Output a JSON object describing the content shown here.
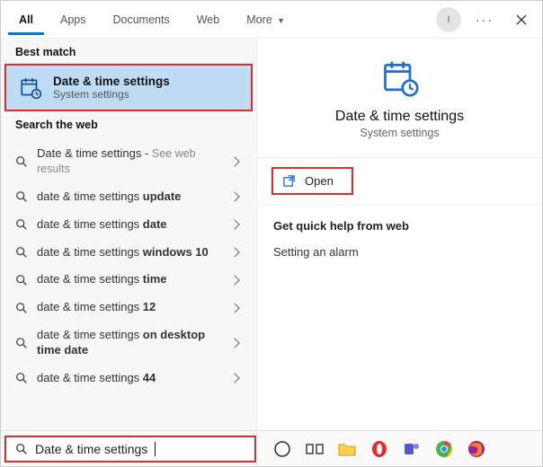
{
  "topbar": {
    "tabs": [
      {
        "label": "All",
        "active": true
      },
      {
        "label": "Apps",
        "active": false
      },
      {
        "label": "Documents",
        "active": false
      },
      {
        "label": "Web",
        "active": false
      }
    ],
    "more_label": "More",
    "avatar_initial": "I"
  },
  "left": {
    "best_match_label": "Best match",
    "best_match": {
      "title": "Date & time settings",
      "subtitle": "System settings"
    },
    "search_web_label": "Search the web",
    "web_items": [
      {
        "prefix": "Date & time settings",
        "bold": "",
        "aside": "See web results"
      },
      {
        "prefix": "date & time settings ",
        "bold": "update",
        "aside": ""
      },
      {
        "prefix": "date & time settings ",
        "bold": "date",
        "aside": ""
      },
      {
        "prefix": "date & time settings ",
        "bold": "windows 10",
        "aside": ""
      },
      {
        "prefix": "date & time settings ",
        "bold": "time",
        "aside": ""
      },
      {
        "prefix": "date & time settings ",
        "bold": "12",
        "aside": ""
      },
      {
        "prefix": "date & time settings ",
        "bold": "on desktop time date",
        "aside": ""
      },
      {
        "prefix": "date & time settings ",
        "bold": "44",
        "aside": ""
      }
    ]
  },
  "right": {
    "feature_title": "Date & time settings",
    "feature_subtitle": "System settings",
    "open_label": "Open",
    "help_title": "Get quick help from web",
    "help_items": [
      "Setting an alarm"
    ]
  },
  "bottom": {
    "search_value": "Date & time settings"
  }
}
